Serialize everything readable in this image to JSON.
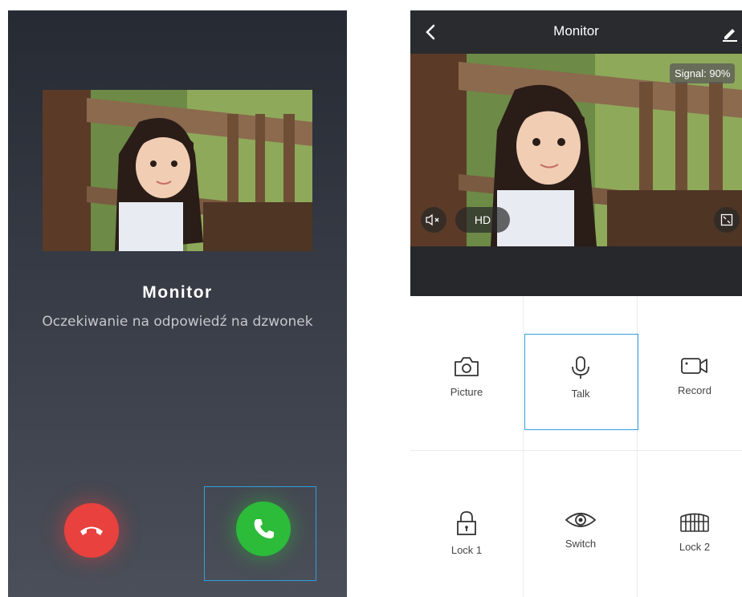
{
  "call_screen": {
    "title": "Monitor",
    "subtitle": "Oczekiwanie na odpowiedź na dzwonek",
    "decline_icon": "phone-hangup-icon",
    "accept_icon": "phone-accept-icon",
    "colors": {
      "decline": "#e8413e",
      "accept": "#2dbb3a",
      "highlight": "#2f9fe0"
    }
  },
  "monitor_screen": {
    "header": {
      "title": "Monitor",
      "back_icon": "chevron-left-icon",
      "edit_icon": "edit-icon"
    },
    "video": {
      "signal_label": "Signal: 90%",
      "quality_label": "HD",
      "mute_icon": "speaker-muted-icon",
      "fullscreen_icon": "fullscreen-icon"
    },
    "actions": [
      {
        "label": "Picture",
        "icon": "camera-icon"
      },
      {
        "label": "Talk",
        "icon": "microphone-icon"
      },
      {
        "label": "Record",
        "icon": "video-camera-icon"
      },
      {
        "label": "Lock 1",
        "icon": "lock-icon"
      },
      {
        "label": "Switch",
        "icon": "eye-icon"
      },
      {
        "label": "Lock 2",
        "icon": "gate-icon"
      }
    ]
  }
}
